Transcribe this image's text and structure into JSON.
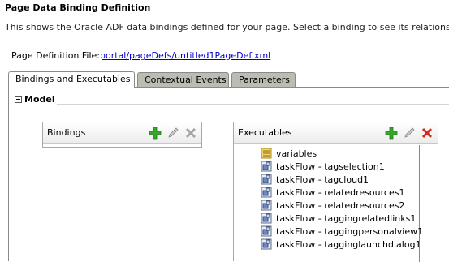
{
  "header": {
    "title": "Page Data Binding Definition",
    "description": "This shows the Oracle ADF data bindings defined for your page. Select a binding to see its relationship"
  },
  "page_definition": {
    "label": "Page Definition File:",
    "file": "portal/pageDefs/untitled1PageDef.xml"
  },
  "tabs": [
    {
      "label": "Bindings and Executables",
      "selected": true
    },
    {
      "label": "Contextual Events",
      "selected": false
    },
    {
      "label": "Parameters",
      "selected": false
    }
  ],
  "model": {
    "label": "Model"
  },
  "bindings_panel": {
    "title": "Bindings",
    "icons": [
      "add-icon",
      "edit-icon",
      "delete-icon"
    ]
  },
  "executables_panel": {
    "title": "Executables",
    "icons": [
      "add-icon",
      "edit-icon",
      "delete-icon"
    ],
    "items": [
      {
        "label": "variables",
        "icon": "variables-icon"
      },
      {
        "label": "taskFlow - tagselection1",
        "icon": "taskflow-icon"
      },
      {
        "label": "taskFlow - tagcloud1",
        "icon": "taskflow-icon"
      },
      {
        "label": "taskFlow - relatedresources1",
        "icon": "taskflow-icon"
      },
      {
        "label": "taskFlow - relatedresources2",
        "icon": "taskflow-icon"
      },
      {
        "label": "taskFlow - taggingrelatedlinks1",
        "icon": "taskflow-icon"
      },
      {
        "label": "taskFlow - taggingpersonalview1",
        "icon": "taskflow-icon"
      },
      {
        "label": "taskFlow - tagginglaunchdialog1",
        "icon": "taskflow-icon"
      }
    ]
  },
  "colors": {
    "accent_green": "#3aa52a",
    "delete_red": "#d42a1a",
    "tab_inactive": "#b9bdb2",
    "link": "#0000cc"
  }
}
